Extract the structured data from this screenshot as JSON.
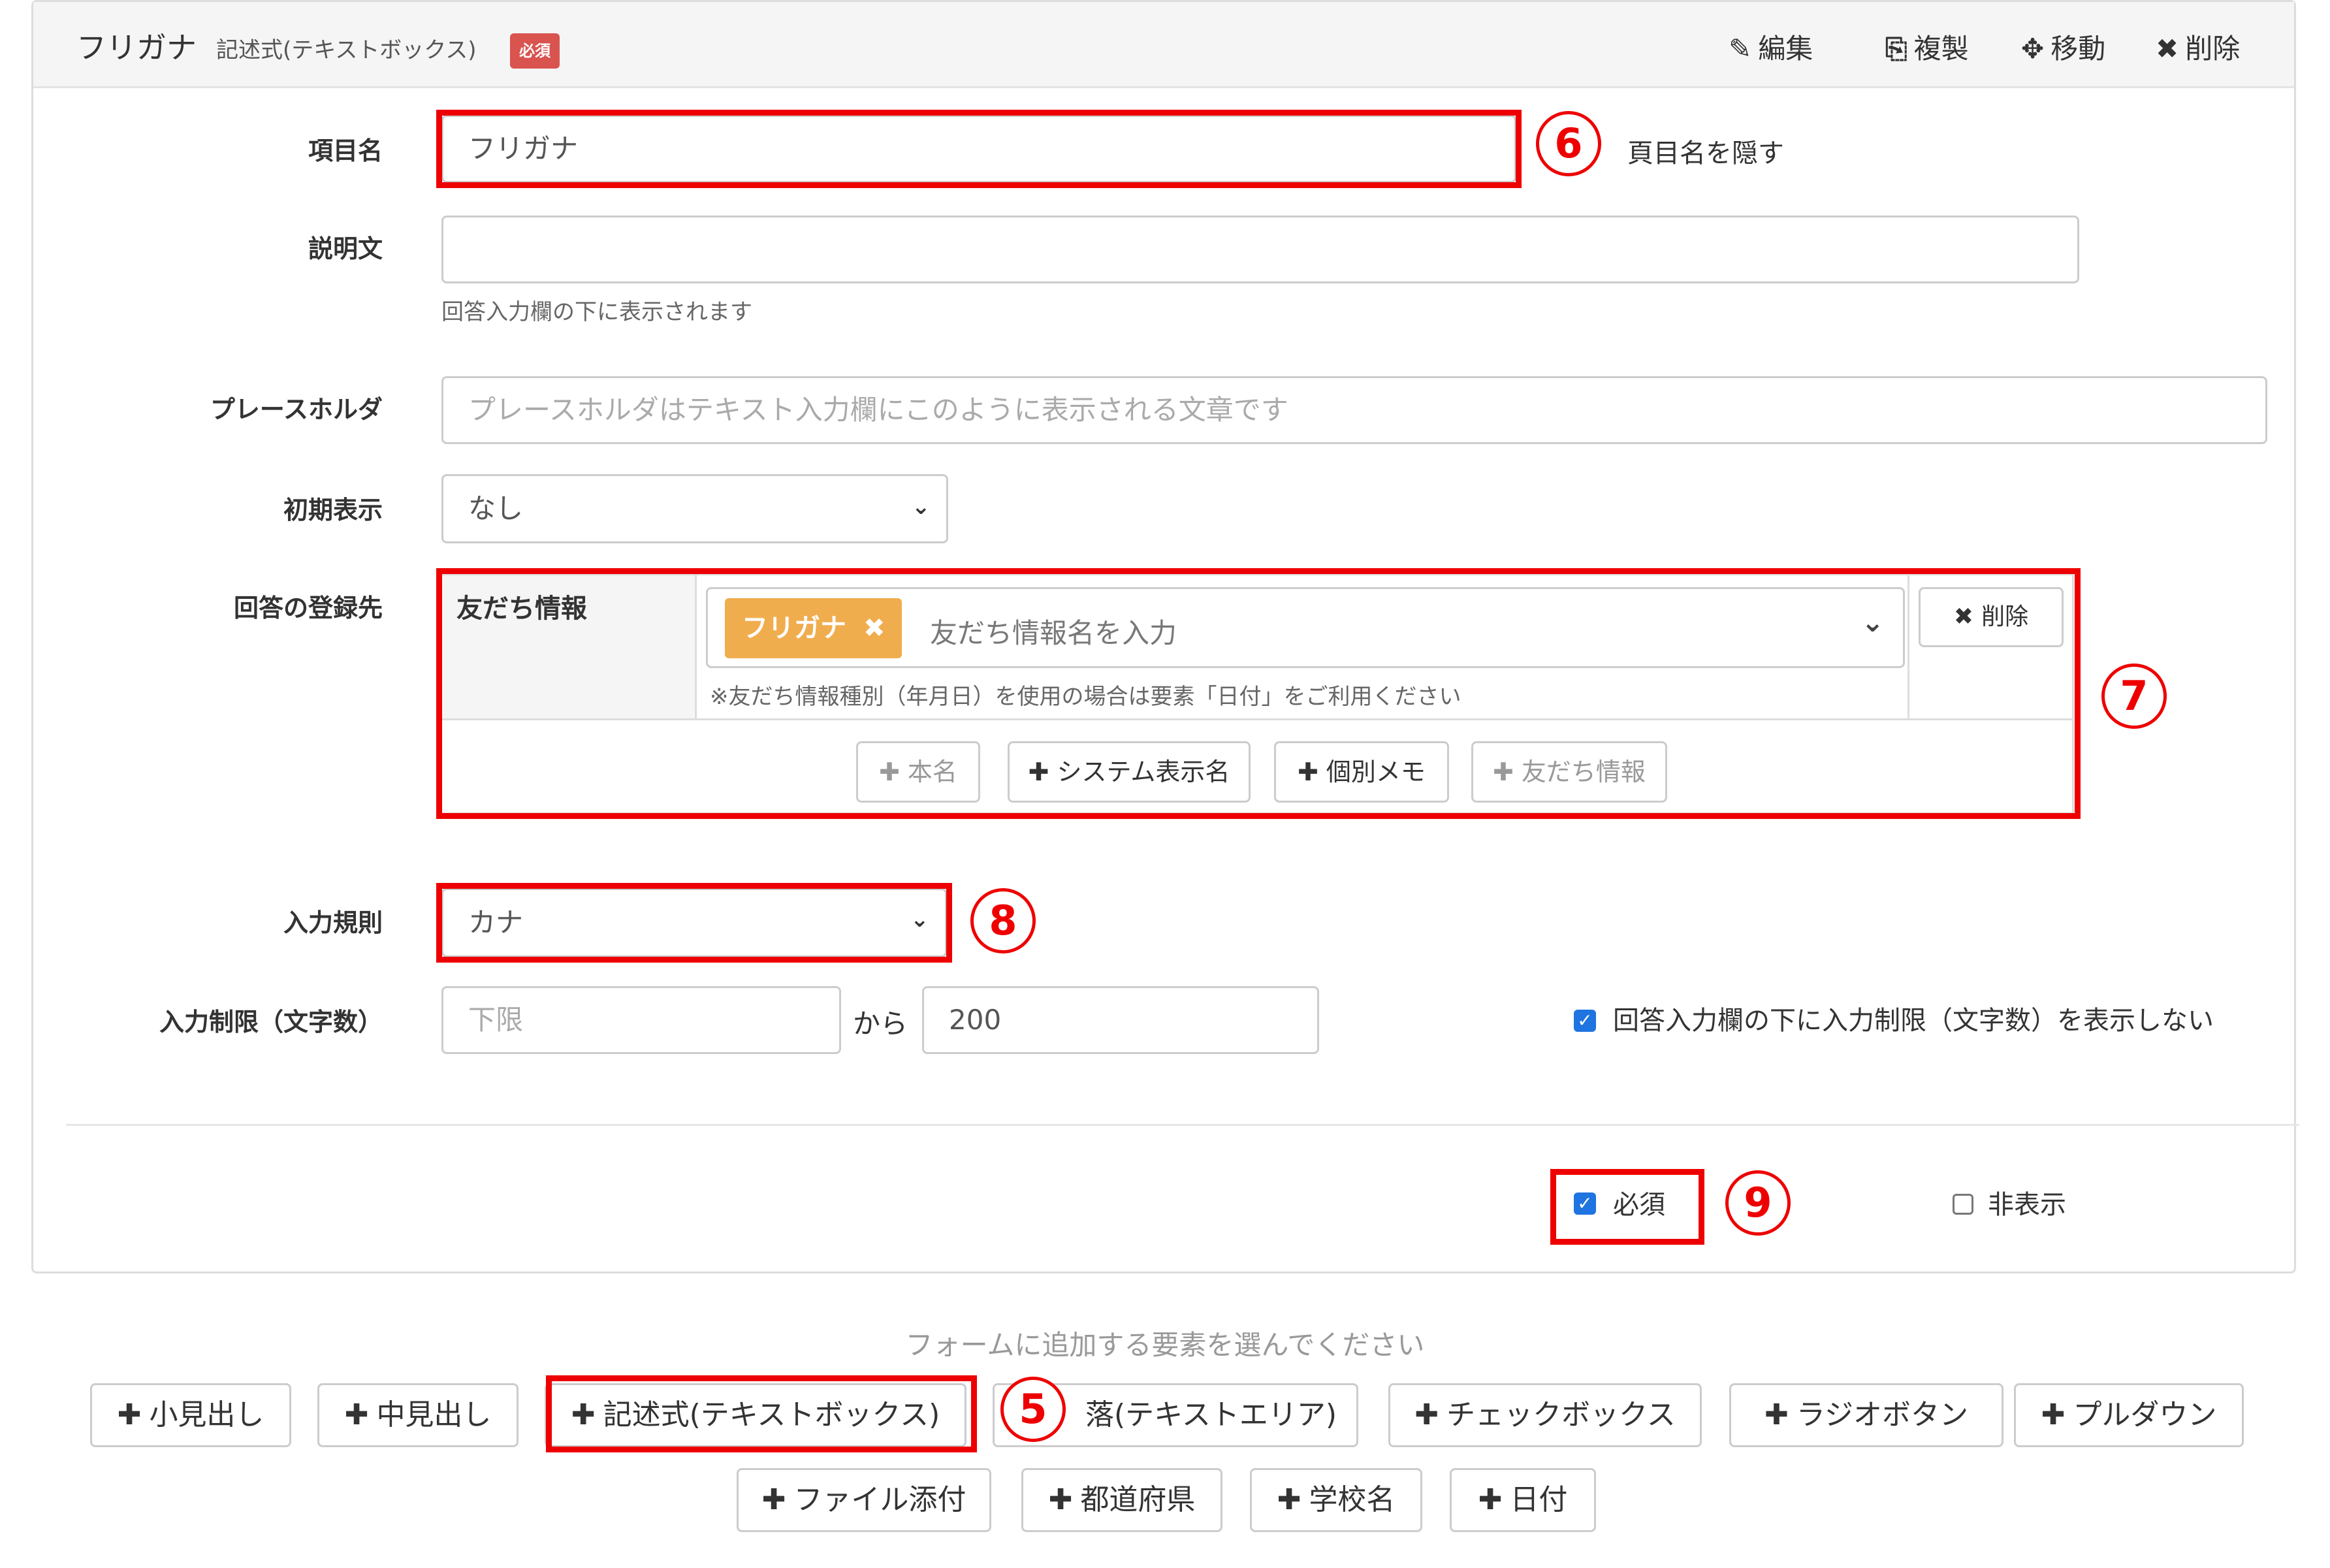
{
  "header": {
    "title": "フリガナ",
    "subtitle": "記述式(テキストボックス)",
    "badge": "必須",
    "actions": {
      "edit": "編集",
      "copy": "複製",
      "move": "移動",
      "delete": "削除"
    }
  },
  "form": {
    "item_name": {
      "label": "項目名",
      "value": "フリガナ",
      "hide_label_text": "頁目名を隠す"
    },
    "description": {
      "label": "説明文",
      "value": "",
      "help": "回答入力欄の下に表示されます"
    },
    "placeholder": {
      "label": "プレースホルダ",
      "placeholder": "プレースホルダはテキスト入力欄にこのように表示される文章です"
    },
    "initial_display": {
      "label": "初期表示",
      "value": "なし"
    },
    "destination": {
      "label": "回答の登録先",
      "column_header": "友だち情報",
      "tag": "フリガナ",
      "input_placeholder": "友だち情報名を入力",
      "note": "※友だち情報種別（年月日）を使用の場合は要素「日付」をご利用ください",
      "delete_label": "削除",
      "buttons": {
        "real_name": "本名",
        "system_name": "システム表示名",
        "memo": "個別メモ",
        "friend_info": "友だち情報"
      }
    },
    "input_rule": {
      "label": "入力規則",
      "value": "カナ"
    },
    "char_limit": {
      "label": "入力制限（文字数）",
      "min_placeholder": "下限",
      "from_text": "から",
      "max_value": "200",
      "hide_limit_text": "回答入力欄の下に入力制限（文字数）を表示しない",
      "hide_limit_checked": true
    },
    "required": {
      "label": "必須",
      "checked": true
    },
    "hidden": {
      "label": "非表示",
      "checked": false
    }
  },
  "add_elements": {
    "prompt": "フォームに追加する要素を選んでください",
    "row1": [
      "小見出し",
      "中見出し",
      "記述式(テキストボックス)",
      "落(テキストエリア)",
      "チェックボックス",
      "ラジオボタン",
      "プルダウン"
    ],
    "row2": [
      "ファイル添付",
      "都道府県",
      "学校名",
      "日付"
    ]
  },
  "annotations": {
    "m5": "5",
    "m6": "6",
    "m7": "7",
    "m8": "8",
    "m9": "9"
  },
  "colors": {
    "annotation_red": "#ee0000",
    "badge_red": "#d9534f",
    "tag_orange": "#f0ad4e",
    "checkbox_blue": "#1e74e0"
  }
}
